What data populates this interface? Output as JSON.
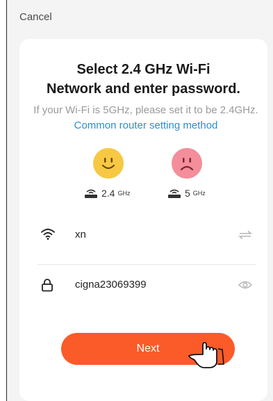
{
  "header": {
    "cancel_label": "Cancel"
  },
  "card": {
    "title_line1": "Select 2.4 GHz Wi-Fi",
    "title_line2": "Network and enter password.",
    "subtitle_text": "If your Wi-Fi is 5GHz, please set it to be 2.4GHz. ",
    "subtitle_link": "Common router setting method"
  },
  "bands": [
    {
      "number": "2.4",
      "unit": "GHz",
      "icon": "router-icon",
      "face": "smile"
    },
    {
      "number": "5",
      "unit": "GHz",
      "icon": "router-icon",
      "face": "frown"
    }
  ],
  "wifi": {
    "ssid": "xn",
    "icon": "wifi-icon",
    "switch_icon": "swap-arrows-icon"
  },
  "password": {
    "value": "cigna23069399",
    "icon": "lock-icon",
    "toggle_icon": "eye-icon"
  },
  "next_label": "Next",
  "colors": {
    "accent": "#fb5a29",
    "link": "#2a8fcf",
    "happy_face": "#f7c843",
    "sad_face": "#f38e9a"
  }
}
